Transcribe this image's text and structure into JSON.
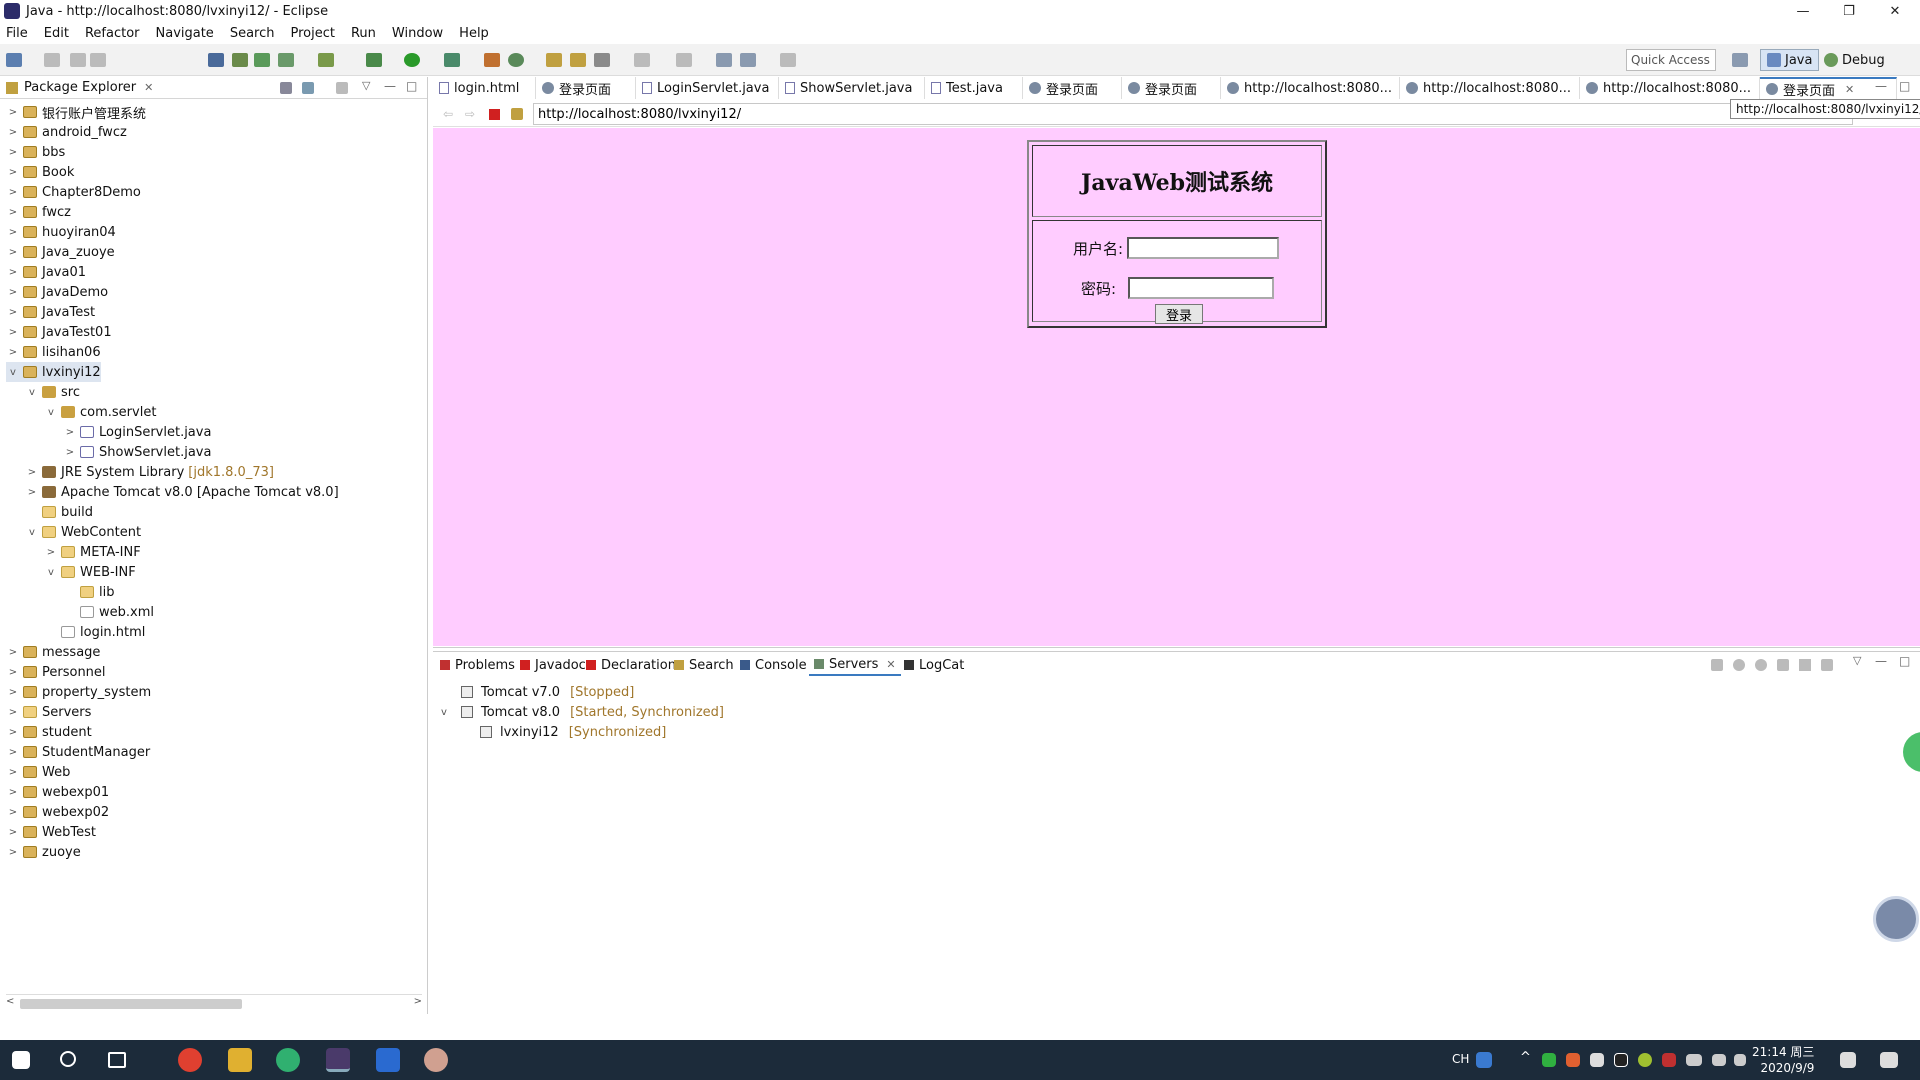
{
  "window": {
    "title": "Java - http://localhost:8080/lvxinyi12/ - Eclipse",
    "min": "—",
    "max": "❐",
    "close": "✕"
  },
  "menu": [
    "File",
    "Edit",
    "Refactor",
    "Navigate",
    "Search",
    "Project",
    "Run",
    "Window",
    "Help"
  ],
  "toolbar": {
    "quick_access": "Quick Access",
    "persp_java": "Java",
    "persp_debug": "Debug"
  },
  "explorer": {
    "title": "Package Explorer",
    "items": [
      {
        "label": "银行账户管理系统",
        "depth": 0,
        "tw": ">",
        "icon": "proj"
      },
      {
        "label": "android_fwcz",
        "depth": 0,
        "tw": ">",
        "icon": "proj"
      },
      {
        "label": "bbs",
        "depth": 0,
        "tw": ">",
        "icon": "proj"
      },
      {
        "label": "Book",
        "depth": 0,
        "tw": ">",
        "icon": "proj"
      },
      {
        "label": "Chapter8Demo",
        "depth": 0,
        "tw": ">",
        "icon": "proj"
      },
      {
        "label": "fwcz",
        "depth": 0,
        "tw": ">",
        "icon": "proj"
      },
      {
        "label": "huoyiran04",
        "depth": 0,
        "tw": ">",
        "icon": "proj"
      },
      {
        "label": "Java_zuoye",
        "depth": 0,
        "tw": ">",
        "icon": "proj"
      },
      {
        "label": "Java01",
        "depth": 0,
        "tw": ">",
        "icon": "proj"
      },
      {
        "label": "JavaDemo",
        "depth": 0,
        "tw": ">",
        "icon": "proj"
      },
      {
        "label": "JavaTest",
        "depth": 0,
        "tw": ">",
        "icon": "proj"
      },
      {
        "label": "JavaTest01",
        "depth": 0,
        "tw": ">",
        "icon": "proj"
      },
      {
        "label": "lisihan06",
        "depth": 0,
        "tw": ">",
        "icon": "proj"
      },
      {
        "label": "lvxinyi12",
        "depth": 0,
        "tw": "v",
        "icon": "proj",
        "selected": true
      },
      {
        "label": "src",
        "depth": 1,
        "tw": "v",
        "icon": "pkg"
      },
      {
        "label": "com.servlet",
        "depth": 2,
        "tw": "v",
        "icon": "pkg"
      },
      {
        "label": "LoginServlet.java",
        "depth": 3,
        "tw": ">",
        "icon": "java"
      },
      {
        "label": "ShowServlet.java",
        "depth": 3,
        "tw": ">",
        "icon": "java"
      },
      {
        "label": "JRE System Library",
        "dim": "[jdk1.8.0_73]",
        "depth": 1,
        "tw": ">",
        "icon": "lib"
      },
      {
        "label": "Apache Tomcat v8.0 [Apache Tomcat v8.0]",
        "depth": 1,
        "tw": ">",
        "icon": "lib"
      },
      {
        "label": "build",
        "depth": 1,
        "tw": "",
        "icon": "folder"
      },
      {
        "label": "WebContent",
        "depth": 1,
        "tw": "v",
        "icon": "folder"
      },
      {
        "label": "META-INF",
        "depth": 2,
        "tw": ">",
        "icon": "folder"
      },
      {
        "label": "WEB-INF",
        "depth": 2,
        "tw": "v",
        "icon": "folder"
      },
      {
        "label": "lib",
        "depth": 3,
        "tw": "",
        "icon": "folder"
      },
      {
        "label": "web.xml",
        "depth": 3,
        "tw": "",
        "icon": "file"
      },
      {
        "label": "login.html",
        "depth": 2,
        "tw": "",
        "icon": "file"
      },
      {
        "label": "message",
        "depth": 0,
        "tw": ">",
        "icon": "proj"
      },
      {
        "label": "Personnel",
        "depth": 0,
        "tw": ">",
        "icon": "proj"
      },
      {
        "label": "property_system",
        "depth": 0,
        "tw": ">",
        "icon": "proj"
      },
      {
        "label": "Servers",
        "depth": 0,
        "tw": ">",
        "icon": "folder"
      },
      {
        "label": "student",
        "depth": 0,
        "tw": ">",
        "icon": "proj"
      },
      {
        "label": "StudentManager",
        "depth": 0,
        "tw": ">",
        "icon": "proj"
      },
      {
        "label": "Web",
        "depth": 0,
        "tw": ">",
        "icon": "proj"
      },
      {
        "label": "webexp01",
        "depth": 0,
        "tw": ">",
        "icon": "proj"
      },
      {
        "label": "webexp02",
        "depth": 0,
        "tw": ">",
        "icon": "proj"
      },
      {
        "label": "WebTest",
        "depth": 0,
        "tw": ">",
        "icon": "proj"
      },
      {
        "label": "zuoye",
        "depth": 0,
        "tw": ">",
        "icon": "proj"
      }
    ]
  },
  "editor_tabs": [
    {
      "label": "login.html",
      "kind": "file"
    },
    {
      "label": "登录页面",
      "kind": "web"
    },
    {
      "label": "LoginServlet.java",
      "kind": "file"
    },
    {
      "label": "ShowServlet.java",
      "kind": "file"
    },
    {
      "label": "Test.java",
      "kind": "file"
    },
    {
      "label": "登录页面",
      "kind": "web"
    },
    {
      "label": "登录页面",
      "kind": "web"
    },
    {
      "label": "http://localhost:8080...",
      "kind": "web"
    },
    {
      "label": "http://localhost:8080...",
      "kind": "web"
    },
    {
      "label": "http://localhost:8080...",
      "kind": "web"
    },
    {
      "label": "登录页面",
      "kind": "web",
      "active": true
    }
  ],
  "browser": {
    "url": "http://localhost:8080/lvxinyi12/",
    "tooltip": "http://localhost:8080/lvxinyi12/",
    "page_bg": "#ffccff"
  },
  "login": {
    "title": "JavaWeb测试系统",
    "user_label": "用户名:",
    "pass_label": "密码:",
    "button": "登录"
  },
  "bottom_tabs": [
    "Problems",
    "Javadoc",
    "Declaration",
    "Search",
    "Console",
    "Servers",
    "LogCat"
  ],
  "servers": [
    {
      "name": "Tomcat v7.0",
      "status": "[Stopped]",
      "depth": 0,
      "tw": ""
    },
    {
      "name": "Tomcat v8.0",
      "status": "[Started, Synchronized]",
      "depth": 0,
      "tw": "v"
    },
    {
      "name": "lvxinyi12",
      "status": "[Synchronized]",
      "depth": 1,
      "tw": ""
    }
  ],
  "taskbar": {
    "lang": "CH",
    "time": "21:14 周三",
    "date": "2020/9/9"
  }
}
